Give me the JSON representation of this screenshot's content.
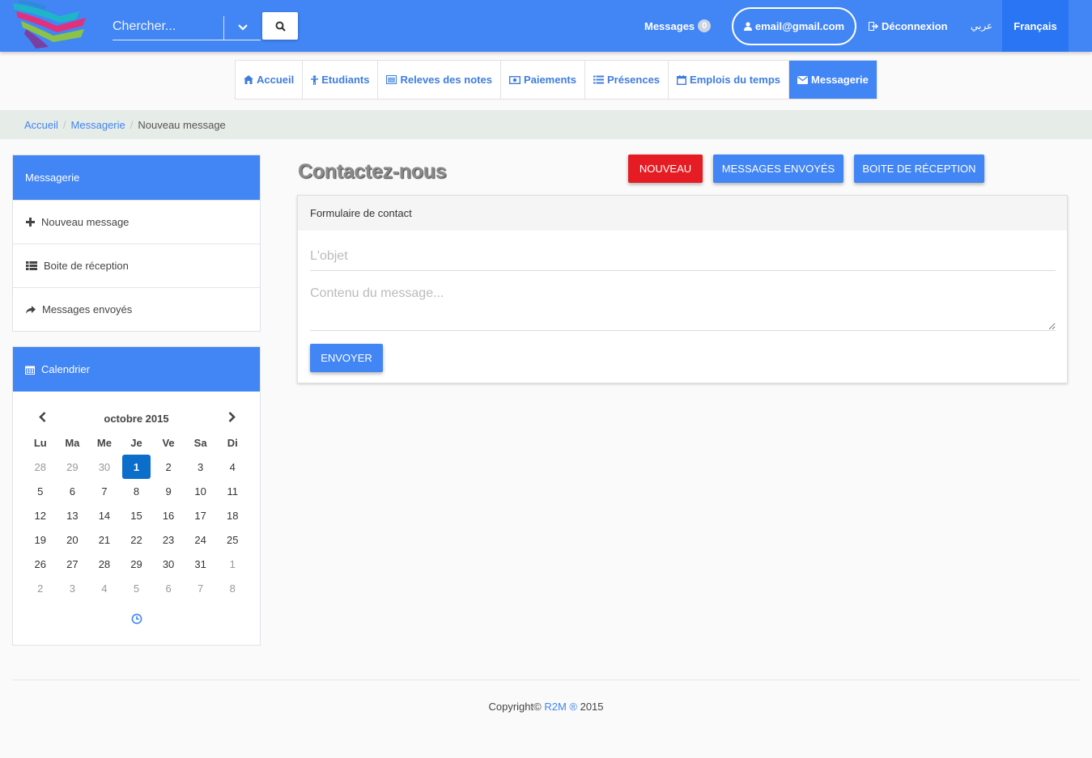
{
  "header": {
    "search_placeholder": "Chercher...",
    "messages_label": "Messages",
    "messages_count": "0",
    "email": "email@gmail.com",
    "logout_label": "Déconnexion",
    "lang_arabic": "عربي",
    "lang_french": "Français"
  },
  "tabs": [
    {
      "label": "Accueil",
      "icon": "home-icon"
    },
    {
      "label": "Etudiants",
      "icon": "student-icon"
    },
    {
      "label": "Releves des notes",
      "icon": "list-icon"
    },
    {
      "label": "Paiements",
      "icon": "money-icon"
    },
    {
      "label": "Présences",
      "icon": "list-icon"
    },
    {
      "label": "Emplois du temps",
      "icon": "calendar-icon"
    },
    {
      "label": "Messagerie",
      "icon": "envelope-icon",
      "active": true
    }
  ],
  "breadcrumb": {
    "home": "Accueil",
    "section": "Messagerie",
    "current": "Nouveau message"
  },
  "sidebar": {
    "title": "Messagerie",
    "items": [
      {
        "label": "Nouveau message",
        "icon": "plus-icon"
      },
      {
        "label": "Boite de réception",
        "icon": "list-icon"
      },
      {
        "label": "Messages envoyés",
        "icon": "share-icon"
      }
    ]
  },
  "calendar": {
    "title": "Calendrier",
    "month_label": "octobre 2015",
    "weekdays": [
      "Lu",
      "Ma",
      "Me",
      "Je",
      "Ve",
      "Sa",
      "Di"
    ],
    "days": [
      [
        "28",
        "29",
        "30",
        "1",
        "2",
        "3",
        "4"
      ],
      [
        "5",
        "6",
        "7",
        "8",
        "9",
        "10",
        "11"
      ],
      [
        "12",
        "13",
        "14",
        "15",
        "16",
        "17",
        "18"
      ],
      [
        "19",
        "20",
        "21",
        "22",
        "23",
        "24",
        "25"
      ],
      [
        "26",
        "27",
        "28",
        "29",
        "30",
        "31",
        "1"
      ],
      [
        "2",
        "3",
        "4",
        "5",
        "6",
        "7",
        "8"
      ]
    ],
    "selected_day": "1"
  },
  "main": {
    "title": "Contactez-nous",
    "btn_new": "Nouveau",
    "btn_sent": "Messages envoyés",
    "btn_inbox": "Boite de réception",
    "form_title": "Formulaire de contact",
    "subject_placeholder": "L'objet",
    "body_placeholder": "Contenu du message...",
    "send_label": "Envoyer"
  },
  "footer": {
    "prefix": "Copyright©",
    "brand": "R2M ®",
    "year": "2015"
  },
  "colors": {
    "primary": "#4285f4",
    "danger": "#e51c23",
    "selected_day": "#0b6ecb"
  }
}
